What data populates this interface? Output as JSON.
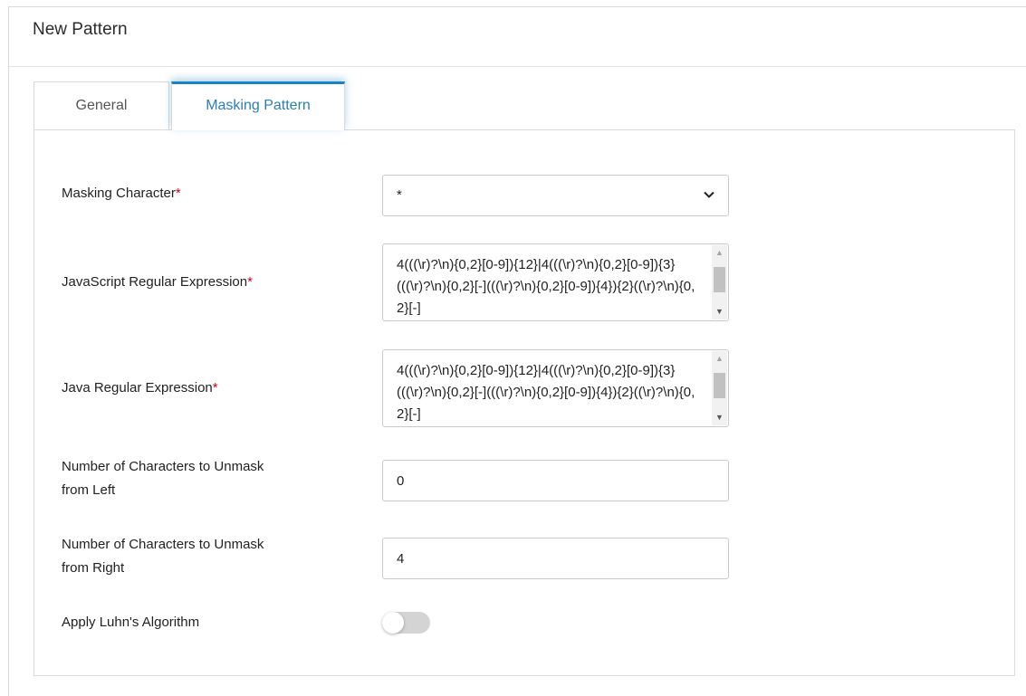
{
  "header": {
    "title": "New Pattern"
  },
  "tabs": [
    {
      "label": "General",
      "active": false
    },
    {
      "label": "Masking Pattern",
      "active": true
    }
  ],
  "form": {
    "masking_character": {
      "label": "Masking Character",
      "required_marker": "*",
      "value": "*"
    },
    "javascript_regex": {
      "label": "JavaScript Regular Expression",
      "required_marker": "*",
      "value": "4(((\\r)?\\n){0,2}[0-9]){12}|4(((\\r)?\\n){0,2}[0-9]){3}(((\\r)?\\n){0,2}[-](((\\r)?\\n){0,2}[0-9]){4}){2}((\\r)?\\n){0,2}[-]"
    },
    "java_regex": {
      "label": "Java Regular Expression",
      "required_marker": "*",
      "value": "4(((\\r)?\\n){0,2}[0-9]){12}|4(((\\r)?\\n){0,2}[0-9]){3}(((\\r)?\\n){0,2}[-](((\\r)?\\n){0,2}[0-9]){4}){2}((\\r)?\\n){0,2}[-]"
    },
    "unmask_left": {
      "label_line1": "Number of Characters to Unmask",
      "label_line2": "from Left",
      "value": "0"
    },
    "unmask_right": {
      "label_line1": "Number of Characters to Unmask",
      "label_line2": "from Right",
      "value": "4"
    },
    "luhn": {
      "label": "Apply Luhn's Algorithm",
      "enabled": false
    }
  },
  "colors": {
    "accent": "#1a83c6",
    "required": "#d0021b",
    "toggle_off": "#d4d4d4"
  }
}
